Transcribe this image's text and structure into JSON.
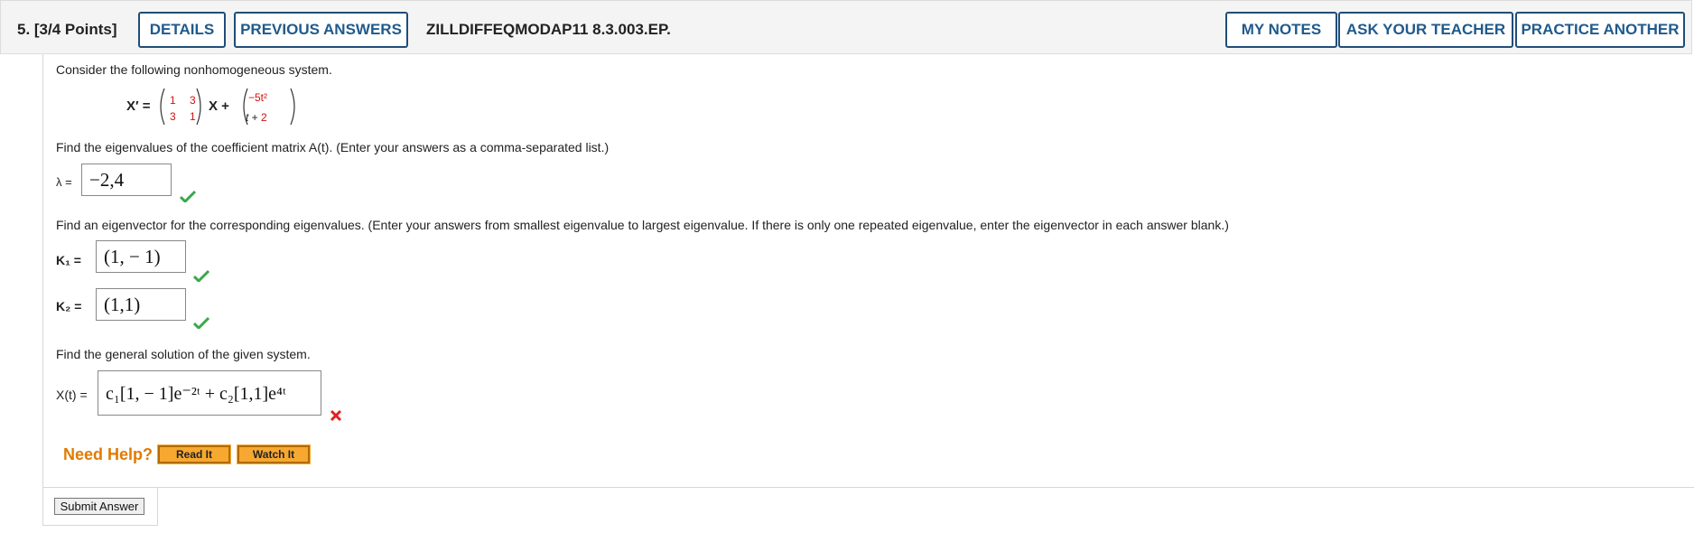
{
  "header": {
    "question_label": "5.  [3/4 Points]",
    "details": "DETAILS",
    "previous_answers": "PREVIOUS ANSWERS",
    "problem_code": "ZILLDIFFEQMODAP11 8.3.003.EP.",
    "my_notes": "MY NOTES",
    "ask_teacher": "ASK YOUR TEACHER",
    "practice_another": "PRACTICE ANOTHER"
  },
  "problem": {
    "intro": "Consider the following nonhomogeneous system.",
    "eq_lhs": "X′ =",
    "matrix": [
      "1",
      "3",
      "3",
      "1"
    ],
    "eq_mid": "X +",
    "forcing_top": "−5t²",
    "forcing_bottom": "t + 2",
    "q1": "Find the eigenvalues of the coefficient matrix A(t). (Enter your answers as a comma-separated list.)",
    "lambda_label": "λ =",
    "lambda_value": "−2,4",
    "q2": "Find an eigenvector for the corresponding eigenvalues. (Enter your answers from smallest eigenvalue to largest eigenvalue. If there is only one repeated eigenvalue, enter the eigenvector in each answer blank.)",
    "k1_label": "K₁  =",
    "k1_value": "(1, − 1)",
    "k2_label": "K₂  =",
    "k2_value": "(1,1)",
    "q3": "Find the general solution of the given system.",
    "x_label": "X(t) =",
    "x_value": "c₁[1, − 1]e⁻²ᵗ + c₂[1,1]e⁴ᵗ"
  },
  "help": {
    "need_help": "Need Help?",
    "read_it": "Read It",
    "watch_it": "Watch It"
  },
  "submit_label": "Submit Answer",
  "colors": {
    "accent": "#1f5a8c",
    "correct": "#3aa84a",
    "incorrect": "#e02020",
    "help": "#e07b00"
  }
}
